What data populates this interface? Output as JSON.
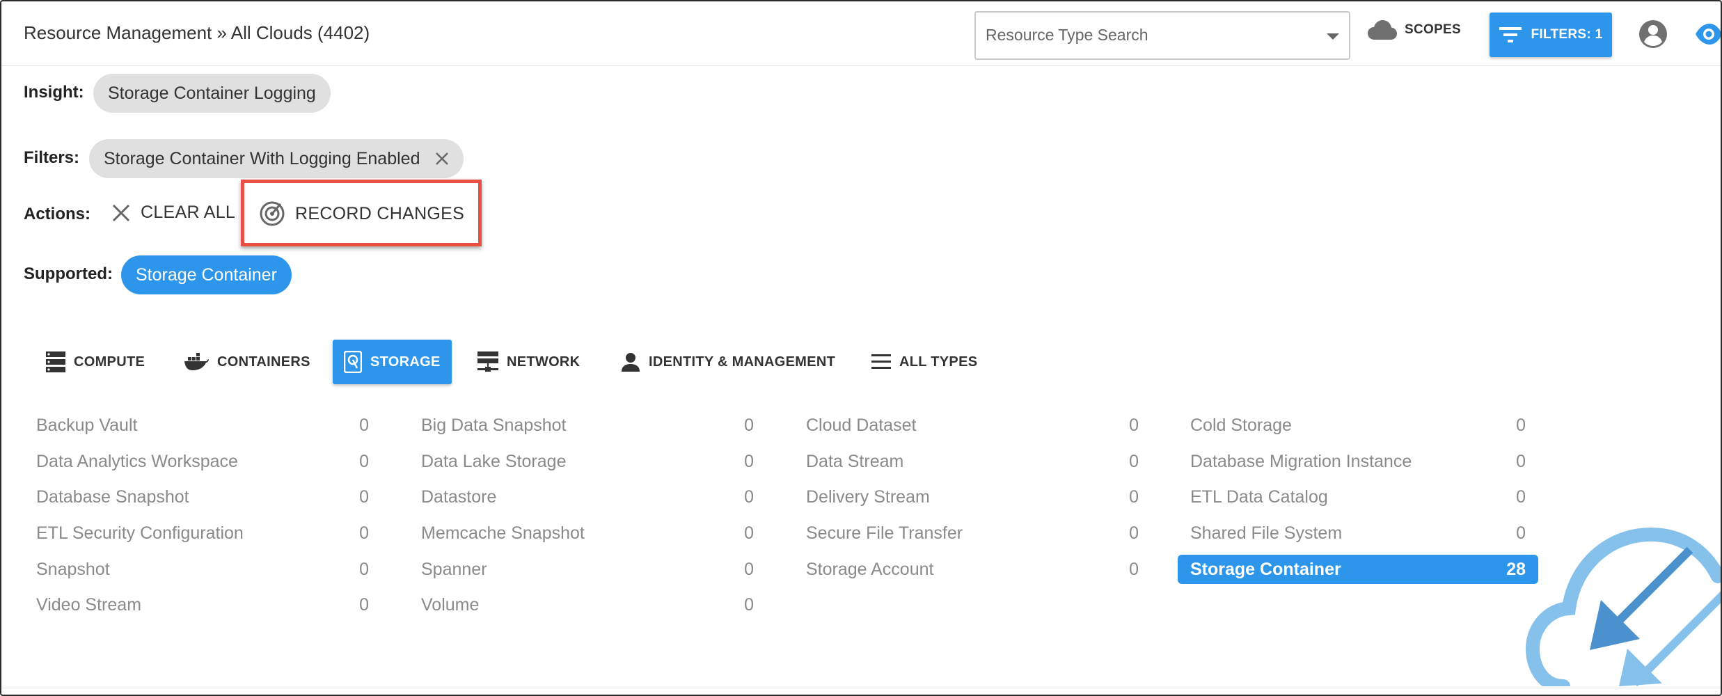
{
  "header": {
    "breadcrumb": "Resource Management » All Clouds (4402)",
    "search_placeholder": "Resource Type Search",
    "scopes_label": "SCOPES",
    "filters_label": "FILTERS: 1"
  },
  "insight": {
    "label": "Insight:",
    "chip": "Storage Container Logging"
  },
  "filters": {
    "label": "Filters:",
    "chip": "Storage Container With Logging Enabled"
  },
  "actions": {
    "label": "Actions:",
    "clear_all": "CLEAR ALL",
    "record_changes": "RECORD CHANGES"
  },
  "supported": {
    "label": "Supported:",
    "chip": "Storage Container"
  },
  "tabs": [
    {
      "label": "COMPUTE",
      "icon": "server-icon"
    },
    {
      "label": "CONTAINERS",
      "icon": "docker-icon"
    },
    {
      "label": "STORAGE",
      "icon": "hard-drive-icon",
      "active": true
    },
    {
      "label": "NETWORK",
      "icon": "network-icon"
    },
    {
      "label": "IDENTITY & MANAGEMENT",
      "icon": "person-icon"
    },
    {
      "label": "ALL TYPES",
      "icon": "list-icon"
    }
  ],
  "types": [
    {
      "name": "Backup Vault",
      "count": "0"
    },
    {
      "name": "Big Data Snapshot",
      "count": "0"
    },
    {
      "name": "Cloud Dataset",
      "count": "0"
    },
    {
      "name": "Cold Storage",
      "count": "0"
    },
    {
      "name": "Data Analytics Workspace",
      "count": "0"
    },
    {
      "name": "Data Lake Storage",
      "count": "0"
    },
    {
      "name": "Data Stream",
      "count": "0"
    },
    {
      "name": "Database Migration Instance",
      "count": "0"
    },
    {
      "name": "Database Snapshot",
      "count": "0"
    },
    {
      "name": "Datastore",
      "count": "0"
    },
    {
      "name": "Delivery Stream",
      "count": "0"
    },
    {
      "name": "ETL Data Catalog",
      "count": "0"
    },
    {
      "name": "ETL Security Configuration",
      "count": "0"
    },
    {
      "name": "Memcache Snapshot",
      "count": "0"
    },
    {
      "name": "Secure File Transfer",
      "count": "0"
    },
    {
      "name": "Shared File System",
      "count": "0"
    },
    {
      "name": "Snapshot",
      "count": "0"
    },
    {
      "name": "Spanner",
      "count": "0"
    },
    {
      "name": "Storage Account",
      "count": "0"
    },
    {
      "name": "Storage Container",
      "count": "28",
      "selected": true
    },
    {
      "name": "Video Stream",
      "count": "0"
    },
    {
      "name": "Volume",
      "count": "0"
    }
  ],
  "colors": {
    "accent": "#2d96ea",
    "highlight": "#ea4f45",
    "chip": "#e0e0e0",
    "muted_text": "#8a8a8a"
  }
}
